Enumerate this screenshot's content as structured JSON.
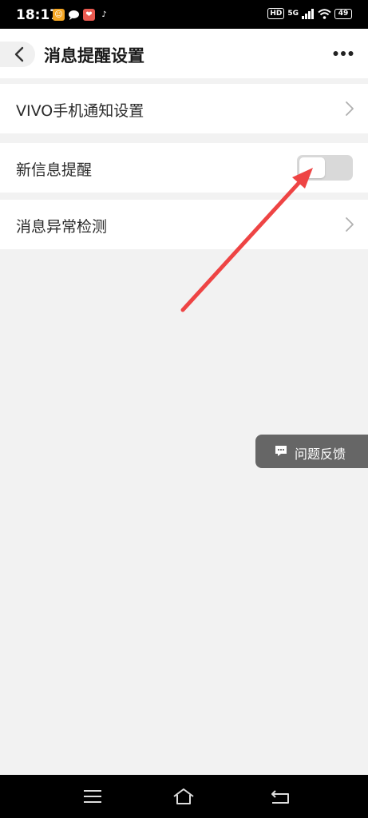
{
  "status_bar": {
    "time": "18:17",
    "hd": "HD",
    "network": "5G",
    "battery": "49"
  },
  "header": {
    "title": "消息提醒设置"
  },
  "settings": [
    {
      "label": "VIVO手机通知设置",
      "control": "chevron"
    },
    {
      "label": "新信息提醒",
      "control": "toggle",
      "toggle_on": false
    },
    {
      "label": "消息异常检测",
      "control": "chevron"
    }
  ],
  "feedback": {
    "label": "问题反馈"
  },
  "colors": {
    "annotation_arrow": "#ee4444",
    "feedback_bg": "#666666",
    "toggle_off": "#d9d9d9"
  }
}
